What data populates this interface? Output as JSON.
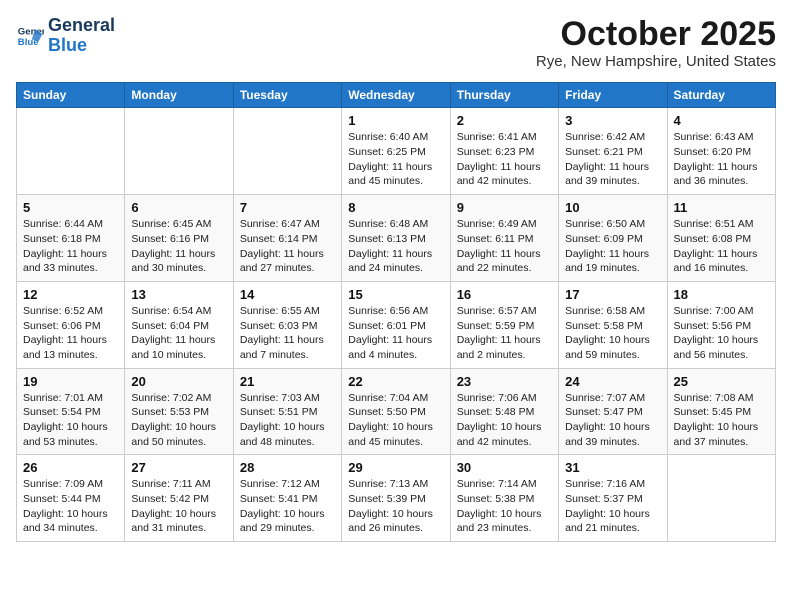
{
  "header": {
    "logo_line1": "General",
    "logo_line2": "Blue",
    "month": "October 2025",
    "location": "Rye, New Hampshire, United States"
  },
  "weekdays": [
    "Sunday",
    "Monday",
    "Tuesday",
    "Wednesday",
    "Thursday",
    "Friday",
    "Saturday"
  ],
  "weeks": [
    [
      {
        "day": "",
        "info": ""
      },
      {
        "day": "",
        "info": ""
      },
      {
        "day": "",
        "info": ""
      },
      {
        "day": "1",
        "info": "Sunrise: 6:40 AM\nSunset: 6:25 PM\nDaylight: 11 hours and 45 minutes."
      },
      {
        "day": "2",
        "info": "Sunrise: 6:41 AM\nSunset: 6:23 PM\nDaylight: 11 hours and 42 minutes."
      },
      {
        "day": "3",
        "info": "Sunrise: 6:42 AM\nSunset: 6:21 PM\nDaylight: 11 hours and 39 minutes."
      },
      {
        "day": "4",
        "info": "Sunrise: 6:43 AM\nSunset: 6:20 PM\nDaylight: 11 hours and 36 minutes."
      }
    ],
    [
      {
        "day": "5",
        "info": "Sunrise: 6:44 AM\nSunset: 6:18 PM\nDaylight: 11 hours and 33 minutes."
      },
      {
        "day": "6",
        "info": "Sunrise: 6:45 AM\nSunset: 6:16 PM\nDaylight: 11 hours and 30 minutes."
      },
      {
        "day": "7",
        "info": "Sunrise: 6:47 AM\nSunset: 6:14 PM\nDaylight: 11 hours and 27 minutes."
      },
      {
        "day": "8",
        "info": "Sunrise: 6:48 AM\nSunset: 6:13 PM\nDaylight: 11 hours and 24 minutes."
      },
      {
        "day": "9",
        "info": "Sunrise: 6:49 AM\nSunset: 6:11 PM\nDaylight: 11 hours and 22 minutes."
      },
      {
        "day": "10",
        "info": "Sunrise: 6:50 AM\nSunset: 6:09 PM\nDaylight: 11 hours and 19 minutes."
      },
      {
        "day": "11",
        "info": "Sunrise: 6:51 AM\nSunset: 6:08 PM\nDaylight: 11 hours and 16 minutes."
      }
    ],
    [
      {
        "day": "12",
        "info": "Sunrise: 6:52 AM\nSunset: 6:06 PM\nDaylight: 11 hours and 13 minutes."
      },
      {
        "day": "13",
        "info": "Sunrise: 6:54 AM\nSunset: 6:04 PM\nDaylight: 11 hours and 10 minutes."
      },
      {
        "day": "14",
        "info": "Sunrise: 6:55 AM\nSunset: 6:03 PM\nDaylight: 11 hours and 7 minutes."
      },
      {
        "day": "15",
        "info": "Sunrise: 6:56 AM\nSunset: 6:01 PM\nDaylight: 11 hours and 4 minutes."
      },
      {
        "day": "16",
        "info": "Sunrise: 6:57 AM\nSunset: 5:59 PM\nDaylight: 11 hours and 2 minutes."
      },
      {
        "day": "17",
        "info": "Sunrise: 6:58 AM\nSunset: 5:58 PM\nDaylight: 10 hours and 59 minutes."
      },
      {
        "day": "18",
        "info": "Sunrise: 7:00 AM\nSunset: 5:56 PM\nDaylight: 10 hours and 56 minutes."
      }
    ],
    [
      {
        "day": "19",
        "info": "Sunrise: 7:01 AM\nSunset: 5:54 PM\nDaylight: 10 hours and 53 minutes."
      },
      {
        "day": "20",
        "info": "Sunrise: 7:02 AM\nSunset: 5:53 PM\nDaylight: 10 hours and 50 minutes."
      },
      {
        "day": "21",
        "info": "Sunrise: 7:03 AM\nSunset: 5:51 PM\nDaylight: 10 hours and 48 minutes."
      },
      {
        "day": "22",
        "info": "Sunrise: 7:04 AM\nSunset: 5:50 PM\nDaylight: 10 hours and 45 minutes."
      },
      {
        "day": "23",
        "info": "Sunrise: 7:06 AM\nSunset: 5:48 PM\nDaylight: 10 hours and 42 minutes."
      },
      {
        "day": "24",
        "info": "Sunrise: 7:07 AM\nSunset: 5:47 PM\nDaylight: 10 hours and 39 minutes."
      },
      {
        "day": "25",
        "info": "Sunrise: 7:08 AM\nSunset: 5:45 PM\nDaylight: 10 hours and 37 minutes."
      }
    ],
    [
      {
        "day": "26",
        "info": "Sunrise: 7:09 AM\nSunset: 5:44 PM\nDaylight: 10 hours and 34 minutes."
      },
      {
        "day": "27",
        "info": "Sunrise: 7:11 AM\nSunset: 5:42 PM\nDaylight: 10 hours and 31 minutes."
      },
      {
        "day": "28",
        "info": "Sunrise: 7:12 AM\nSunset: 5:41 PM\nDaylight: 10 hours and 29 minutes."
      },
      {
        "day": "29",
        "info": "Sunrise: 7:13 AM\nSunset: 5:39 PM\nDaylight: 10 hours and 26 minutes."
      },
      {
        "day": "30",
        "info": "Sunrise: 7:14 AM\nSunset: 5:38 PM\nDaylight: 10 hours and 23 minutes."
      },
      {
        "day": "31",
        "info": "Sunrise: 7:16 AM\nSunset: 5:37 PM\nDaylight: 10 hours and 21 minutes."
      },
      {
        "day": "",
        "info": ""
      }
    ]
  ]
}
